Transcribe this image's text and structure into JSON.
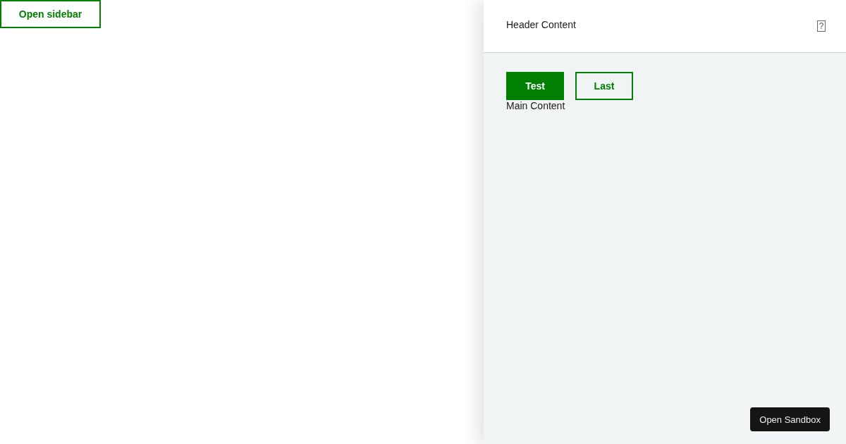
{
  "open_sidebar_button": {
    "label": "Open sidebar"
  },
  "sidebar": {
    "header": {
      "title": "Header Content",
      "help_icon": "?"
    },
    "buttons": [
      {
        "label": "Test",
        "kind": "primary"
      },
      {
        "label": "Last",
        "kind": "outline"
      }
    ],
    "main_text": "Main Content"
  },
  "sandbox_button": {
    "label": "Open Sandbox"
  }
}
